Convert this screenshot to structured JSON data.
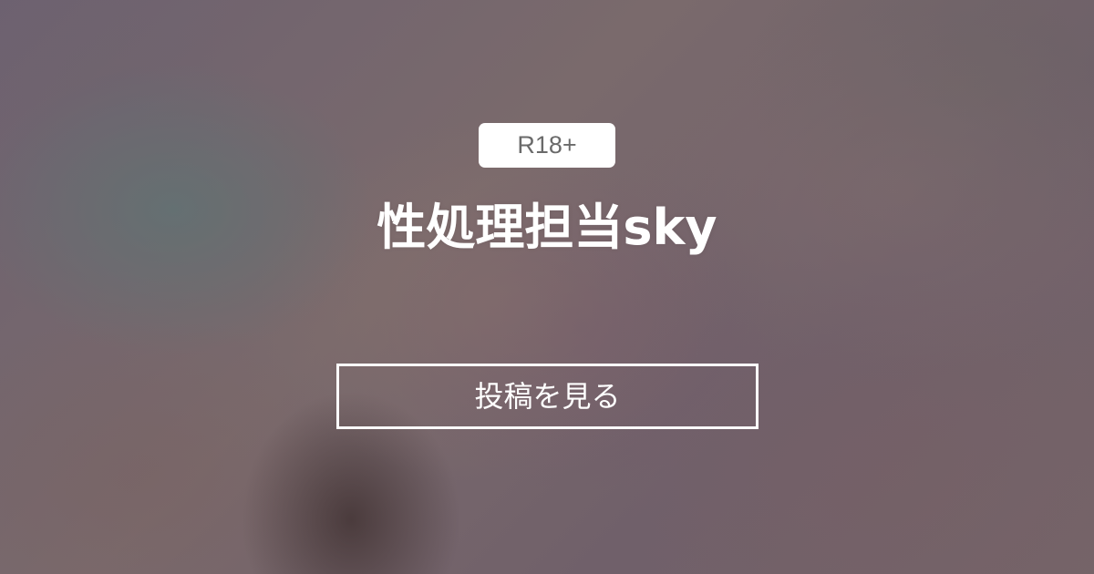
{
  "badge": {
    "label": "R18+"
  },
  "creator": {
    "name": "性処理担当sky"
  },
  "actions": {
    "view_posts_label": "投稿を見る"
  },
  "colors": {
    "badge_background": "#ffffff",
    "badge_text": "#6a6a6a",
    "text": "#ffffff",
    "background": "#75636a"
  }
}
